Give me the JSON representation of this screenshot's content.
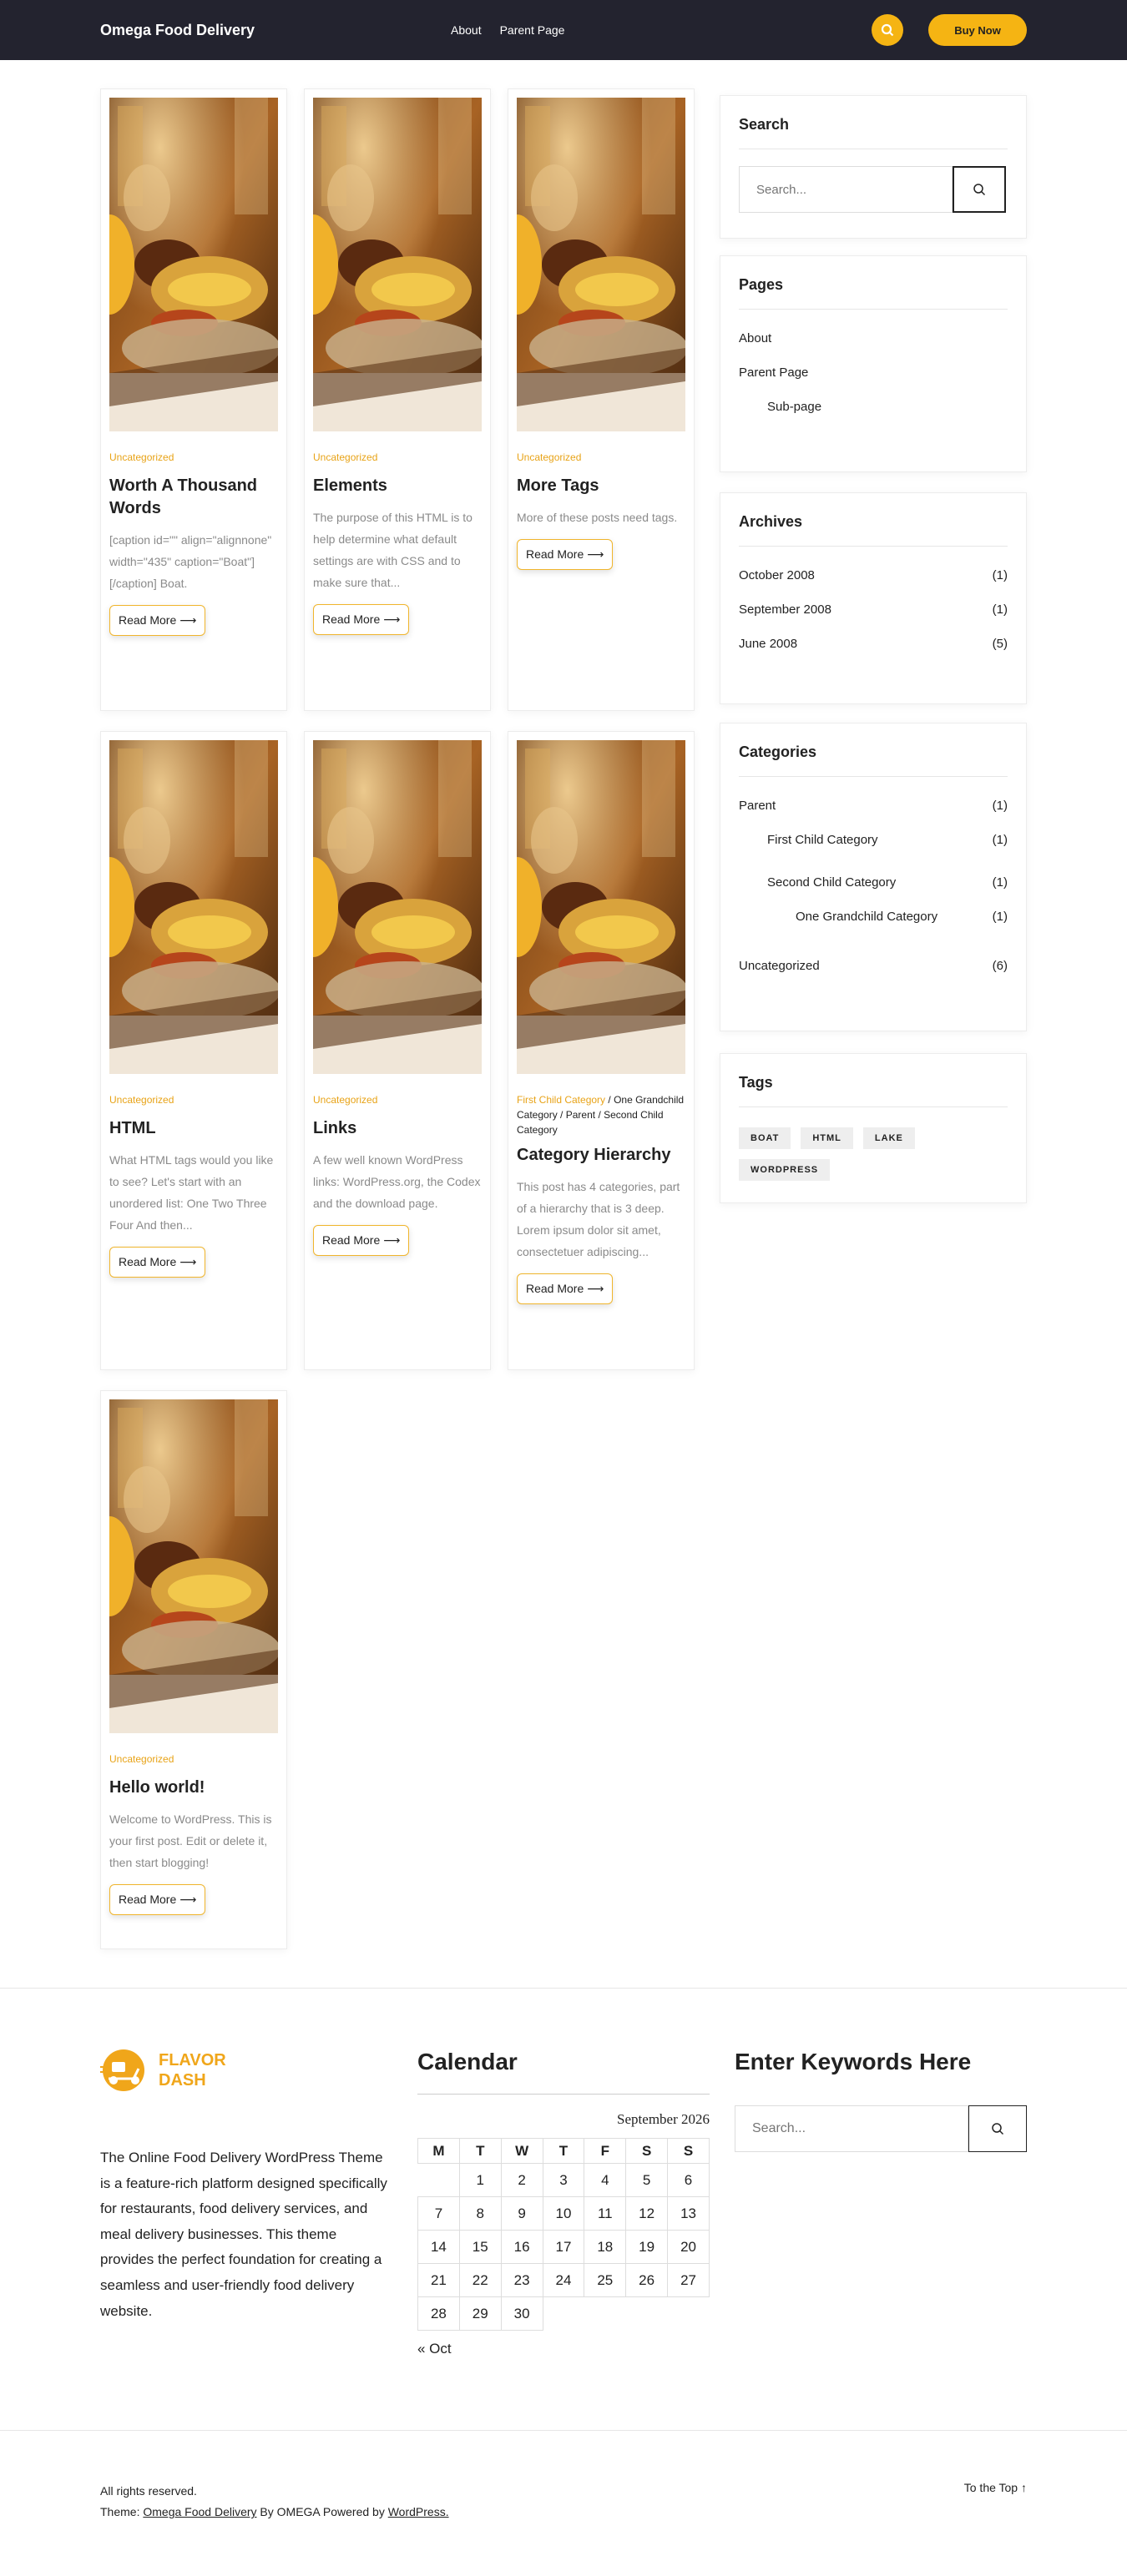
{
  "header": {
    "logo": "Omega Food Delivery",
    "nav": [
      "About",
      "Parent Page"
    ],
    "buy_label": "Buy Now"
  },
  "posts": [
    {
      "category": "Uncategorized",
      "title": "Worth A Thousand Words",
      "excerpt": "[caption id=\"\" align=\"alignnone\" width=\"435\" caption=\"Boat\"][/caption] Boat.",
      "read_more": "Read More"
    },
    {
      "category": "Uncategorized",
      "title": "Elements",
      "excerpt": "The purpose of this HTML is to help determine what default settings are with CSS and to make sure that...",
      "read_more": "Read More"
    },
    {
      "category": "Uncategorized",
      "title": "More Tags",
      "excerpt": "More of these posts need tags.",
      "read_more": "Read More"
    },
    {
      "category": "Uncategorized",
      "title": "HTML",
      "excerpt": "What HTML tags would you like to see? Let's start with an unordered list: One Two Three Four And then...",
      "read_more": "Read More"
    },
    {
      "category": "Uncategorized",
      "title": "Links",
      "excerpt": "A few well known WordPress links: WordPress.org, the Codex and the download page.",
      "read_more": "Read More"
    },
    {
      "category_first": "First Child Category",
      "category_rest": [
        "One Grandchild Category",
        "Parent",
        "Second Child Category"
      ],
      "title": "Category Hierarchy",
      "excerpt": "This post has 4 categories, part of a hierarchy that is 3 deep. Lorem ipsum dolor sit amet, consectetuer adipiscing...",
      "read_more": "Read More"
    },
    {
      "category": "Uncategorized",
      "title": "Hello world!",
      "excerpt": "Welcome to WordPress. This is your first post. Edit or delete it, then start blogging!",
      "read_more": "Read More"
    }
  ],
  "sidebar": {
    "search": {
      "title": "Search",
      "placeholder": "Search..."
    },
    "pages": {
      "title": "Pages",
      "items": [
        "About",
        "Parent Page",
        "Sub-page"
      ]
    },
    "archives": {
      "title": "Archives",
      "items": [
        {
          "label": "October 2008",
          "count": "(1)"
        },
        {
          "label": "September 2008",
          "count": "(1)"
        },
        {
          "label": "June 2008",
          "count": "(5)"
        }
      ]
    },
    "categories": {
      "title": "Categories",
      "items": [
        {
          "label": "Parent",
          "count": "(1)"
        },
        {
          "label": "First Child Category",
          "count": "(1)"
        },
        {
          "label": "Second Child Category",
          "count": "(1)"
        },
        {
          "label": "One Grandchild Category",
          "count": "(1)"
        },
        {
          "label": "Uncategorized",
          "count": "(6)"
        }
      ]
    },
    "tags": {
      "title": "Tags",
      "items": [
        "BOAT",
        "HTML",
        "LAKE",
        "WORDPRESS"
      ]
    }
  },
  "footer": {
    "brand": {
      "line1": "FLAVOR",
      "line2": "DASH"
    },
    "about": "The Online Food Delivery WordPress Theme is a feature-rich platform designed specifically for restaurants, food delivery services, and meal delivery businesses. This theme provides the perfect foundation for creating a seamless and user-friendly food delivery website.",
    "calendar": {
      "title": "Calendar",
      "caption": "September 2026",
      "days": [
        "M",
        "T",
        "W",
        "T",
        "F",
        "S",
        "S"
      ],
      "weeks": [
        [
          "",
          "1",
          "2",
          "3",
          "4",
          "5",
          "6"
        ],
        [
          "7",
          "8",
          "9",
          "10",
          "11",
          "12",
          "13"
        ],
        [
          "14",
          "15",
          "16",
          "17",
          "18",
          "19",
          "20"
        ],
        [
          "21",
          "22",
          "23",
          "24",
          "25",
          "26",
          "27"
        ],
        [
          "28",
          "29",
          "30",
          "",
          "",
          "",
          ""
        ]
      ],
      "prev": "« Oct"
    },
    "keywords": {
      "title": "Enter Keywords Here",
      "placeholder": "Search..."
    },
    "rights": "All rights reserved.",
    "theme_prefix": "Theme:",
    "theme_link": "Omega Food Delivery",
    "by_text": "By OMEGA Powered by",
    "wp_link": "WordPress.",
    "to_top": "To the Top ↑"
  },
  "colors": {
    "accent": "#f5b413",
    "header_bg": "#23232f",
    "category": "#e8a317"
  }
}
